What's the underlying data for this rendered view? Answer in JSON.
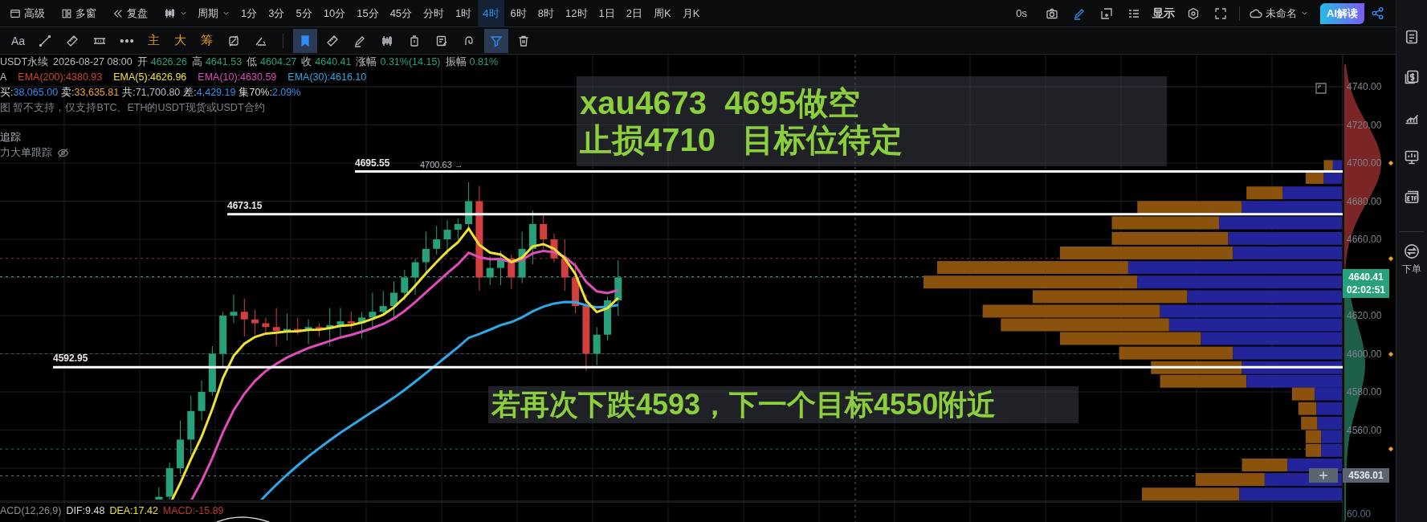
{
  "top_bar": {
    "left_buttons": [
      {
        "kind": "window",
        "label": "高级"
      },
      {
        "kind": "grid",
        "label": "多窗"
      },
      {
        "kind": "rewind",
        "label": "复盘"
      }
    ],
    "period_menu": "周期",
    "intervals": [
      {
        "label": "1分",
        "selected": false
      },
      {
        "label": "3分",
        "selected": false
      },
      {
        "label": "5分",
        "selected": false
      },
      {
        "label": "10分",
        "selected": false
      },
      {
        "label": "15分",
        "selected": false
      },
      {
        "label": "45分",
        "selected": false
      },
      {
        "label": "分时",
        "selected": false
      },
      {
        "label": "1时",
        "selected": false
      },
      {
        "label": "4时",
        "selected": true
      },
      {
        "label": "6时",
        "selected": false
      },
      {
        "label": "8时",
        "selected": false
      },
      {
        "label": "12时",
        "selected": false
      },
      {
        "label": "1日",
        "selected": false
      },
      {
        "label": "2日",
        "selected": false
      },
      {
        "label": "周K",
        "selected": false
      },
      {
        "label": "月K",
        "selected": false
      }
    ],
    "refresh": "0s",
    "display": "显示",
    "layout_name": "未命名",
    "ai_button": "AI解读"
  },
  "toolbar": {
    "font_button": "Aa",
    "indicators": [
      "主",
      "大",
      "筹"
    ],
    "tools": [
      {
        "kind": "bookmark",
        "active": true
      },
      {
        "kind": "ruler",
        "active": false
      },
      {
        "kind": "pencil",
        "active": false
      },
      {
        "kind": "candles",
        "active": false
      },
      {
        "kind": "timer",
        "active": false
      },
      {
        "kind": "note",
        "active": false
      },
      {
        "kind": "magnet",
        "active": false
      },
      {
        "kind": "filter",
        "active": true
      },
      {
        "kind": "trash",
        "active": false
      }
    ]
  },
  "chart": {
    "quote_line": {
      "symbol": "USDT永续",
      "time": "2026-08-27 08:00",
      "fields": [
        {
          "label": "开",
          "value": "4626.26"
        },
        {
          "label": "高",
          "value": "4641.53"
        },
        {
          "label": "低",
          "value": "4604.27"
        },
        {
          "label": "收",
          "value": "4640.41"
        },
        {
          "label": "涨幅",
          "value": "0.31%(14.15)"
        },
        {
          "label": "振幅",
          "value": "0.81%"
        }
      ]
    },
    "ema_line": {
      "name": "A",
      "emas": [
        {
          "text": "EMA(200):4380.93",
          "color": "#d2452d"
        },
        {
          "text": "EMA(5):4626.96",
          "color": "#f2e230"
        },
        {
          "text": "EMA(10):4630.59",
          "color": "#e04cb8"
        },
        {
          "text": "EMA(30):4616.10",
          "color": "#2fa8e6"
        }
      ]
    },
    "order_flow": [
      {
        "label": "买:",
        "value": "38,065.00",
        "color": "#2f8ff0"
      },
      {
        "label": "卖:",
        "value": "33,635.81",
        "color": "#f0a030"
      },
      {
        "label": "共:",
        "value": "71,700.80",
        "color": "#b8bcc4"
      },
      {
        "label": "差:",
        "value": "4,429.19",
        "color": "#2f8ff0"
      },
      {
        "label": "集70%:",
        "value": "2.09%",
        "color": "#2f8ff0"
      }
    ],
    "notice": "图 暂不支持，仅支持BTC、ETH的USDT现货或USDT合约",
    "tracking_title": "追踪",
    "tracking_item": "力大单跟踪",
    "price_labels": [
      "4695.55",
      "4700.63 →",
      "4673.15",
      "4592.95"
    ],
    "annotation_top": [
      "xau4673  4695做空",
      "止损4710   目标位待定"
    ],
    "annotation_bottom": "若再次下跌4593，下一个目标4550附近",
    "price_axis": {
      "ticks": [
        "4740.00",
        "4720.00",
        "4700.00",
        "4680.00",
        "4660.00",
        "4620.00",
        "4600.00",
        "4580.00",
        "4560.00"
      ],
      "current_price": "4640.41",
      "countdown": "02:02:51",
      "crosshair_price": "4536.01",
      "bottom_tick": "60.00"
    },
    "macd": {
      "title": "ACD(12,26,9)",
      "dif": "DIF:9.48",
      "dea": "DEA:17.42",
      "value": "MACD:-15.89"
    }
  },
  "sidebar": {
    "order_label": "下单"
  }
}
